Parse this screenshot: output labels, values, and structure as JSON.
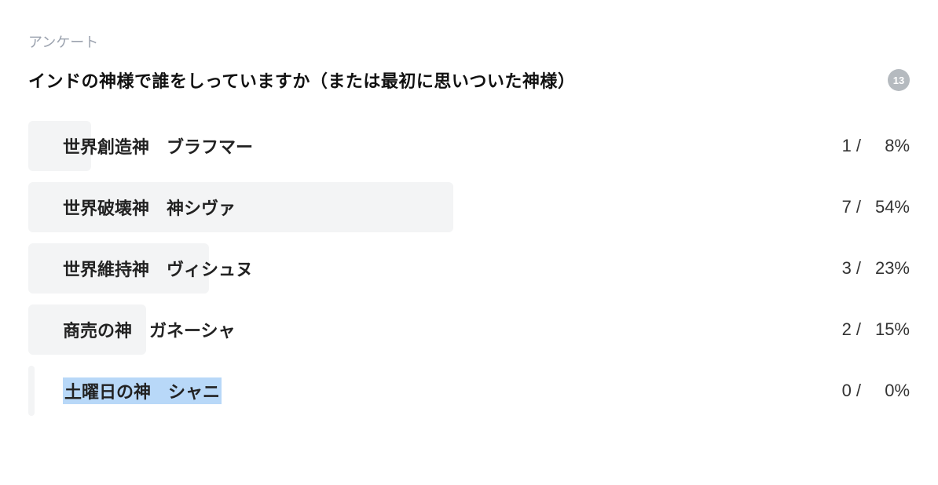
{
  "header": {
    "label": "アンケート",
    "question": "インドの神様で誰をしっていますか（または最初に思いついた神様）",
    "total": "13"
  },
  "options": [
    {
      "label": "世界創造神　ブラフマー",
      "count": "1",
      "pct": "8%",
      "highlight": false
    },
    {
      "label": "世界破壊神　神シヴァ",
      "count": "7",
      "pct": "54%",
      "highlight": false
    },
    {
      "label": "世界維持神　ヴィシュヌ",
      "count": "3",
      "pct": "23%",
      "highlight": false
    },
    {
      "label": "商売の神　ガネーシャ",
      "count": "2",
      "pct": "15%",
      "highlight": false
    },
    {
      "label": "土曜日の神　シャニ",
      "count": "0",
      "pct": "0%",
      "highlight": true
    }
  ],
  "chart_data": {
    "type": "bar",
    "title": "インドの神様で誰をしっていますか（または最初に思いついた神様）",
    "categories": [
      "世界創造神　ブラフマー",
      "世界破壊神　神シヴァ",
      "世界維持神　ヴィシュヌ",
      "商売の神　ガネーシャ",
      "土曜日の神　シャニ"
    ],
    "series": [
      {
        "name": "votes",
        "values": [
          1,
          7,
          3,
          2,
          0
        ]
      },
      {
        "name": "percent",
        "values": [
          8,
          54,
          23,
          15,
          0
        ]
      }
    ],
    "total_responses": 13,
    "xlabel": "",
    "ylabel": "",
    "xlim": [
      0,
      100
    ]
  }
}
